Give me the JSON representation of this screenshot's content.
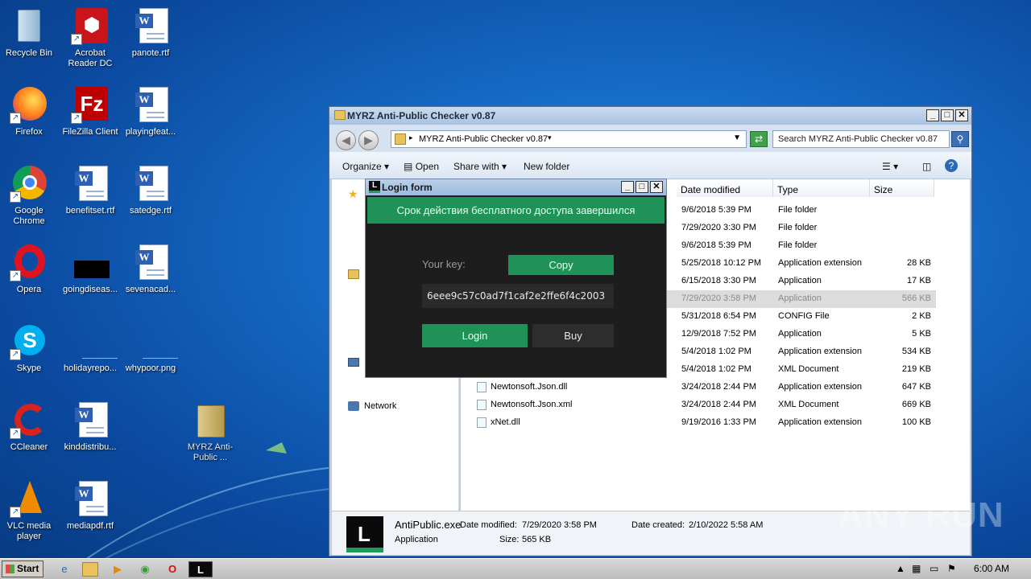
{
  "desktop": {
    "icons": [
      {
        "label": "Recycle Bin"
      },
      {
        "label": "Acrobat Reader DC"
      },
      {
        "label": "panote.rtf"
      },
      {
        "label": "Firefox"
      },
      {
        "label": "FileZilla Client"
      },
      {
        "label": "playingfeat..."
      },
      {
        "label": "Google Chrome"
      },
      {
        "label": "benefitset.rtf"
      },
      {
        "label": "satedge.rtf"
      },
      {
        "label": "Opera"
      },
      {
        "label": "goingdiseas..."
      },
      {
        "label": "sevenacad..."
      },
      {
        "label": "Skype"
      },
      {
        "label": "holidayrepo..."
      },
      {
        "label": "whypoor.png"
      },
      {
        "label": "CCleaner"
      },
      {
        "label": "kinddistribu..."
      },
      {
        "label": "MYRZ Anti-Public ..."
      },
      {
        "label": "VLC media player"
      },
      {
        "label": "mediapdf.rtf"
      }
    ]
  },
  "explorer": {
    "title": "MYRZ Anti-Public Checker v0.87",
    "address": "MYRZ Anti-Public Checker v0.87",
    "search_placeholder": "Search MYRZ Anti-Public Checker v0.87",
    "commands": {
      "organize": "Organize",
      "open": "Open",
      "share": "Share with",
      "new_folder": "New folder"
    },
    "columns": {
      "date": "Date modified",
      "type": "Type",
      "size": "Size"
    },
    "rows": [
      {
        "name": "",
        "date": "9/6/2018 5:39 PM",
        "type": "File folder",
        "size": ""
      },
      {
        "name": "",
        "date": "7/29/2020 3:30 PM",
        "type": "File folder",
        "size": ""
      },
      {
        "name": "",
        "date": "9/6/2018 5:39 PM",
        "type": "File folder",
        "size": ""
      },
      {
        "name": "",
        "date": "5/25/2018 10:12 PM",
        "type": "Application extension",
        "size": "28 KB"
      },
      {
        "name": "",
        "date": "6/15/2018 3:30 PM",
        "type": "Application",
        "size": "17 KB"
      },
      {
        "name": "",
        "date": "7/29/2020 3:58 PM",
        "type": "Application",
        "size": "566 KB"
      },
      {
        "name": "",
        "date": "5/31/2018 6:54 PM",
        "type": "CONFIG File",
        "size": "2 KB"
      },
      {
        "name": "",
        "date": "12/9/2018 7:52 PM",
        "type": "Application",
        "size": "5 KB"
      },
      {
        "name": "",
        "date": "5/4/2018 1:02 PM",
        "type": "Application extension",
        "size": "534 KB"
      },
      {
        "name": "",
        "date": "5/4/2018 1:02 PM",
        "type": "XML Document",
        "size": "219 KB"
      },
      {
        "name": "Newtonsoft.Json.dll",
        "date": "3/24/2018 2:44 PM",
        "type": "Application extension",
        "size": "647 KB"
      },
      {
        "name": "Newtonsoft.Json.xml",
        "date": "3/24/2018 2:44 PM",
        "type": "XML Document",
        "size": "669 KB"
      },
      {
        "name": "xNet.dll",
        "date": "9/19/2016 1:33 PM",
        "type": "Application extension",
        "size": "100 KB"
      }
    ],
    "nav": {
      "network": "Network"
    },
    "details": {
      "name": "AntiPublic.exe",
      "modified_label": "Date modified:",
      "modified": "7/29/2020 3:58 PM",
      "created_label": "Date created:",
      "created": "2/10/2022 5:58 AM",
      "type": "Application",
      "size_label": "Size:",
      "size": "565 KB"
    }
  },
  "login": {
    "title": "Login form",
    "banner": "Срок действия бесплатного доступа завершился",
    "key_label": "Your key:",
    "copy": "Copy",
    "key": "6eee9c57c0ad7f1caf2e2ffe6f4c2003",
    "login": "Login",
    "buy": "Buy"
  },
  "taskbar": {
    "start": "Start",
    "time": "6:00 AM"
  },
  "watermark": "ANY RUN",
  "colors": {
    "accent_green": "#1f9257",
    "dialog_bg": "#1d1d1d"
  }
}
